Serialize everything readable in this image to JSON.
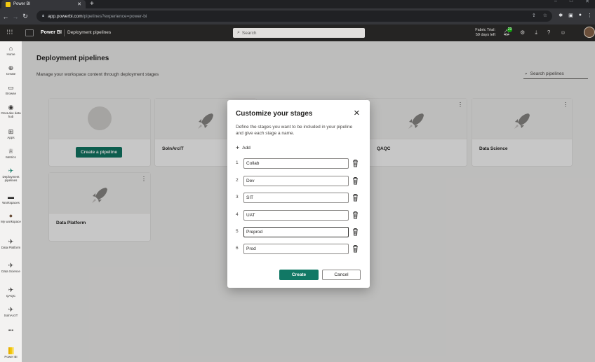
{
  "browser": {
    "tab_title": "Power BI",
    "tab_close": "✕",
    "new_tab": "+",
    "url_host": "app.powerbi.com",
    "url_rest": "/pipelines?experience=power-bi",
    "window_controls": [
      "–",
      "□",
      "✕"
    ]
  },
  "app": {
    "title": "Power BI",
    "breadcrumb": "Deployment pipelines",
    "search_placeholder": "Search",
    "trial_line1": "Fabric Trial:",
    "trial_line2": "59 days left",
    "notification_count": "23"
  },
  "sidebar": {
    "items": [
      {
        "label": "Home",
        "icon": "home-icon"
      },
      {
        "label": "Create",
        "icon": "create-icon"
      },
      {
        "label": "Browse",
        "icon": "browse-icon"
      },
      {
        "label": "OneLake data hub",
        "icon": "onelake-icon"
      },
      {
        "label": "Apps",
        "icon": "apps-icon"
      },
      {
        "label": "Metrics",
        "icon": "metrics-icon"
      },
      {
        "label": "Deployment pipelines",
        "icon": "pipelines-icon"
      },
      {
        "label": "Workspaces",
        "icon": "workspaces-icon"
      },
      {
        "label": "My workspace",
        "icon": "my-workspace-icon"
      },
      {
        "label": "Data Platform",
        "icon": "workspace-icon"
      },
      {
        "label": "Data Science",
        "icon": "workspace-icon"
      },
      {
        "label": "QAQC",
        "icon": "workspace-icon"
      },
      {
        "label": "SolnArcIT",
        "icon": "workspace-icon"
      }
    ],
    "more": "•••",
    "footer_label": "Power BI"
  },
  "page": {
    "title": "Deployment pipelines",
    "subtitle": "Manage your workspace content through deployment stages",
    "search_placeholder": "Search pipelines"
  },
  "cards": {
    "create_label": "Create a pipeline",
    "pipelines": [
      "SolnArcIT",
      "QAQC",
      "Data Science",
      "Data Platform"
    ]
  },
  "dialog": {
    "title": "Customize your stages",
    "close": "✕",
    "description": "Define the stages you want to be included in your pipeline and give each stage a name.",
    "add_label": "Add",
    "stages": [
      {
        "num": "1",
        "name": "Collab"
      },
      {
        "num": "2",
        "name": "Dev"
      },
      {
        "num": "3",
        "name": "SIT"
      },
      {
        "num": "4",
        "name": "UAT"
      },
      {
        "num": "5",
        "name": "Preprod"
      },
      {
        "num": "6",
        "name": "Prod"
      }
    ],
    "create_label": "Create",
    "cancel_label": "Cancel"
  },
  "colors": {
    "accent": "#117865",
    "app_bar": "#252423",
    "browser": "#35363a"
  }
}
